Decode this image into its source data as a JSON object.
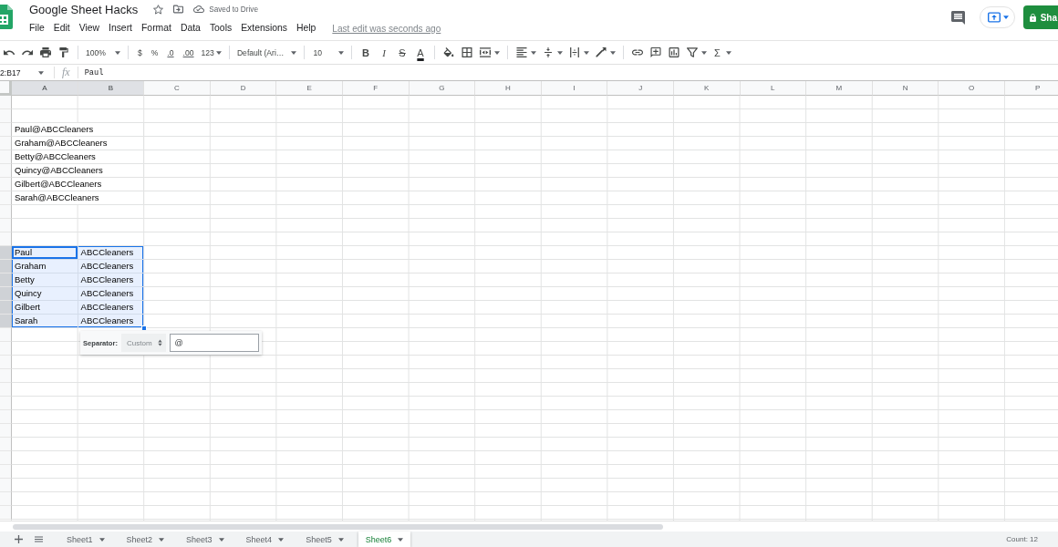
{
  "app": {
    "title": "Google Sheet Hacks",
    "starred": false,
    "save_status": "Saved to Drive",
    "menu": [
      "File",
      "Edit",
      "View",
      "Insert",
      "Format",
      "Data",
      "Tools",
      "Extensions",
      "Help"
    ],
    "last_edit": "Last edit was seconds ago",
    "share": "Sha"
  },
  "toolbar": {
    "zoom": "100%",
    "number_formats": [
      {
        "kind": "currency",
        "label": "$"
      },
      {
        "kind": "percent",
        "label": "%"
      },
      {
        "kind": "decrease_decimals",
        "label": ".0"
      },
      {
        "kind": "increase_decimals",
        "label": ".00"
      }
    ],
    "more_formats": "123",
    "font": "Default (Ari…",
    "font_size": "10",
    "text_styles": [
      {
        "kind": "bold",
        "label": "B"
      },
      {
        "kind": "italic",
        "label": "I"
      },
      {
        "kind": "strikethrough",
        "label": "S"
      },
      {
        "kind": "text_color",
        "label": "A"
      }
    ],
    "functions": "Σ"
  },
  "formula_bar": {
    "name_box": "2:B17",
    "label": "fx",
    "value": "Paul"
  },
  "sheet": {
    "columns": [
      {
        "label": "A",
        "selected": true
      },
      {
        "label": "B",
        "selected": true
      },
      {
        "label": "C",
        "selected": false
      },
      {
        "label": "D",
        "selected": false
      },
      {
        "label": "E",
        "selected": false
      },
      {
        "label": "F",
        "selected": false
      },
      {
        "label": "G",
        "selected": false
      },
      {
        "label": "H",
        "selected": false
      },
      {
        "label": "I",
        "selected": false
      },
      {
        "label": "J",
        "selected": false
      },
      {
        "label": "K",
        "selected": false
      },
      {
        "label": "L",
        "selected": false
      },
      {
        "label": "M",
        "selected": false
      },
      {
        "label": "N",
        "selected": false
      },
      {
        "label": "O",
        "selected": false
      },
      {
        "label": "P",
        "selected": false
      }
    ],
    "rows": [
      {
        "selected": false
      },
      {
        "selected": false
      },
      {
        "selected": false,
        "cells": [
          {
            "text": "Paul@ABCCleaners",
            "selected": false,
            "active": false
          }
        ]
      },
      {
        "selected": false,
        "cells": [
          {
            "text": "Graham@ABCCleaners",
            "selected": false,
            "active": false
          }
        ]
      },
      {
        "selected": false,
        "cells": [
          {
            "text": "Betty@ABCCleaners",
            "selected": false,
            "active": false
          }
        ]
      },
      {
        "selected": false,
        "cells": [
          {
            "text": "Quincy@ABCCleaners",
            "selected": false,
            "active": false
          }
        ]
      },
      {
        "selected": false,
        "cells": [
          {
            "text": "Gilbert@ABCCleaners",
            "selected": false,
            "active": false
          }
        ]
      },
      {
        "selected": false,
        "cells": [
          {
            "text": "Sarah@ABCCleaners",
            "selected": false,
            "active": false
          }
        ]
      },
      {
        "selected": false
      },
      {
        "selected": false
      },
      {
        "selected": false
      },
      {
        "selected": true,
        "cells": [
          {
            "text": "Paul",
            "selected": true,
            "active": true
          },
          {
            "text": "ABCCleaners",
            "selected": true,
            "active": false
          }
        ]
      },
      {
        "selected": true,
        "cells": [
          {
            "text": "Graham",
            "selected": true,
            "active": false
          },
          {
            "text": "ABCCleaners",
            "selected": true,
            "active": false
          }
        ]
      },
      {
        "selected": true,
        "cells": [
          {
            "text": "Betty",
            "selected": true,
            "active": false
          },
          {
            "text": "ABCCleaners",
            "selected": true,
            "active": false
          }
        ]
      },
      {
        "selected": true,
        "cells": [
          {
            "text": "Quincy",
            "selected": true,
            "active": false
          },
          {
            "text": "ABCCleaners",
            "selected": true,
            "active": false
          }
        ]
      },
      {
        "selected": true,
        "cells": [
          {
            "text": "Gilbert",
            "selected": true,
            "active": false
          },
          {
            "text": "ABCCleaners",
            "selected": true,
            "active": false
          }
        ]
      },
      {
        "selected": true,
        "cells": [
          {
            "text": "Sarah",
            "selected": true,
            "active": false
          },
          {
            "text": "ABCCleaners",
            "selected": true,
            "active": false
          }
        ]
      },
      {
        "selected": false
      },
      {
        "selected": false
      },
      {
        "selected": false
      },
      {
        "selected": false
      },
      {
        "selected": false
      },
      {
        "selected": false
      },
      {
        "selected": false
      },
      {
        "selected": false
      },
      {
        "selected": false
      },
      {
        "selected": false
      },
      {
        "selected": false
      },
      {
        "selected": false
      },
      {
        "selected": false
      },
      {
        "selected": false
      }
    ],
    "split_popup": {
      "label": "Separator:",
      "mode": "Custom",
      "value": "@"
    }
  },
  "sheet_tabs": [
    {
      "name": "Sheet1",
      "selected": false
    },
    {
      "name": "Sheet2",
      "selected": false
    },
    {
      "name": "Sheet3",
      "selected": false
    },
    {
      "name": "Sheet4",
      "selected": false
    },
    {
      "name": "Sheet5",
      "selected": false
    },
    {
      "name": "Sheet6",
      "selected": true
    }
  ],
  "status": "Count: 12"
}
